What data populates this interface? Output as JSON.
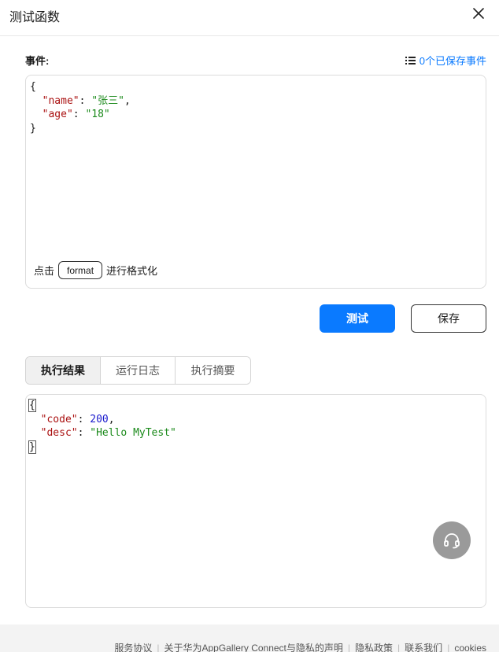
{
  "dialog": {
    "title": "测试函数",
    "close_icon": "close-icon"
  },
  "event": {
    "label": "事件:",
    "saved_link": "0个已保存事件",
    "saved_icon": "list-icon",
    "code_lines": {
      "l1_open": "{",
      "l2_key": "\"name\"",
      "l2_val": "\"张三\"",
      "l3_key": "\"age\"",
      "l3_val": "\"18\"",
      "l4_close": "}"
    },
    "format_prefix": "点击",
    "format_button": "format",
    "format_suffix": "进行格式化"
  },
  "actions": {
    "test_label": "测试",
    "save_label": "保存"
  },
  "tabs": [
    {
      "label": "执行结果",
      "active": true
    },
    {
      "label": "运行日志",
      "active": false
    },
    {
      "label": "执行摘要",
      "active": false
    }
  ],
  "result": {
    "l1_open": "{",
    "l2_key": "\"code\"",
    "l2_val": "200",
    "l3_key": "\"desc\"",
    "l3_val": "\"Hello MyTest\"",
    "l4_close": "}"
  },
  "support_icon": "headset-icon",
  "footer": {
    "links": [
      "服务协议",
      "关于华为AppGallery Connect与隐私的声明",
      "隐私政策",
      "联系我们",
      "cookies"
    ]
  },
  "colors": {
    "accent": "#0a7aff",
    "json_key": "#aa1111",
    "json_string": "#1b8a1b",
    "json_number": "#1a1acd"
  }
}
